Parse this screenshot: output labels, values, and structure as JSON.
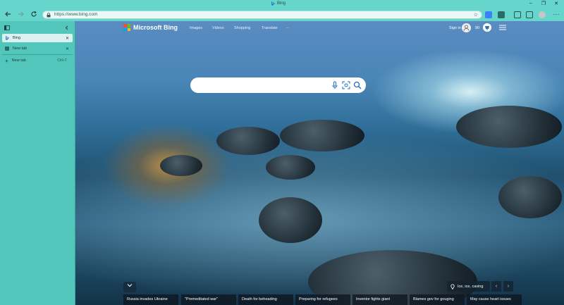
{
  "window": {
    "title": "Bing",
    "controls": [
      "–",
      "❐",
      "✕"
    ]
  },
  "toolbar": {
    "url": "https://www.bing.com"
  },
  "sidebar": {
    "tabs": [
      {
        "label": "Bing",
        "active": true
      },
      {
        "label": "New tab",
        "active": false
      }
    ],
    "new_tab_label": "New tab",
    "new_tab_shortcut": "Ctrl+T"
  },
  "bing": {
    "brand": "Microsoft Bing",
    "nav": [
      "Images",
      "Videos",
      "Shopping",
      "Translate",
      "···"
    ],
    "signin": "Sign in",
    "points": "90",
    "location": "Ice, ice, caving",
    "news": [
      "Russia invades Ukraine",
      "\"Premeditated war\"",
      "Death for beheading",
      "Preparing for refugees",
      "Inventor fights giant",
      "Blames gov for gouging",
      "May cause heart issues"
    ]
  },
  "colors": {
    "browser_chrome": "#66d6cc",
    "sidebar": "#52c6bb",
    "bing_blue": "#0067b8"
  }
}
